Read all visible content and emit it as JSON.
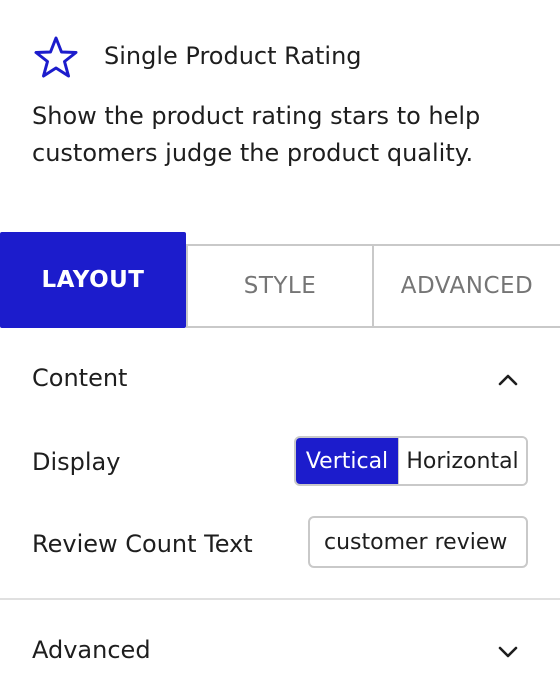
{
  "block": {
    "title": "Single Product Rating",
    "description": "Show the product rating stars to help customers judge the product quality.",
    "icon": "star-icon"
  },
  "tabs": [
    {
      "label": "LAYOUT",
      "active": true
    },
    {
      "label": "STYLE",
      "active": false
    },
    {
      "label": "ADVANCED",
      "active": false
    }
  ],
  "panels": {
    "content": {
      "title": "Content",
      "expanded": true,
      "display": {
        "label": "Display",
        "options": [
          "Vertical",
          "Horizontal"
        ],
        "selected": "Vertical"
      },
      "review_count": {
        "label": "Review Count Text",
        "value": "customer review"
      }
    },
    "advanced": {
      "title": "Advanced",
      "expanded": false
    }
  },
  "colors": {
    "accent": "#1c1ccc",
    "border": "#c9c9c9",
    "text": "#1e1e1e",
    "muted": "#757575"
  }
}
